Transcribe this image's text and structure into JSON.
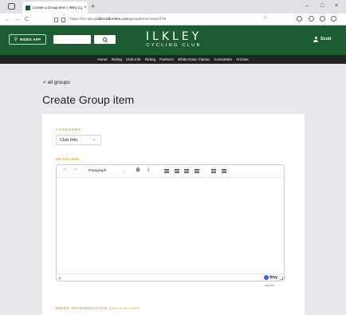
{
  "browser": {
    "tab_title": "Create a Group item | Ilkley Cy...",
    "tab_close": "×",
    "new_tab": "+",
    "url_prefix": "https://icc-dev.",
    "url_domain": "codecraftonline.com",
    "url_path": "/groupitem/create/1?8",
    "back": "←",
    "forward": "→",
    "reload": "C",
    "minimize": "–",
    "maximize": "□",
    "close": "×",
    "star": "☆"
  },
  "header": {
    "rides_app": "RIDES APP",
    "logo_main": "ILKLEY",
    "logo_sub": "CYCLING CLUB",
    "user_name": "Scott"
  },
  "nav": [
    "Home",
    "Riding",
    "Club Info",
    "Riding",
    "Partners",
    "White Rose Classic",
    "Committee",
    "Archive"
  ],
  "page": {
    "back_link": "< all groups",
    "title": "Create Group item"
  },
  "form": {
    "category_label": "CATEGORY",
    "category_value": "Club Info",
    "headline_label": "HEADLINE",
    "paragraph": "Paragraph",
    "status_path": "p",
    "tiny_brand": "tiny",
    "char_count": "max 0/4",
    "intro_label": "BRIEF INTRODUCTION",
    "intro_hint": "(one or two lines)"
  }
}
